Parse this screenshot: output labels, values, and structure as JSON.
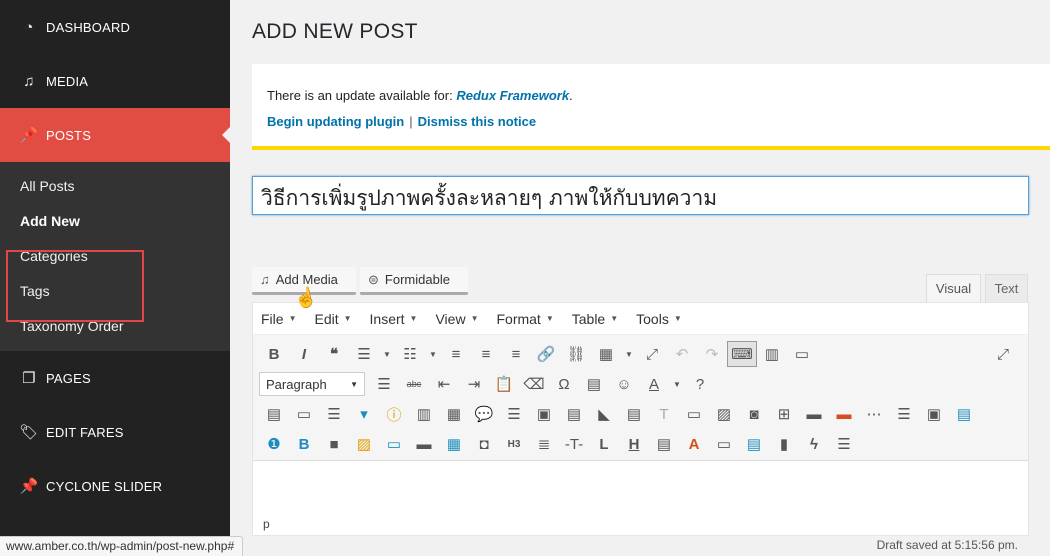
{
  "sidebar": {
    "top_items": [
      {
        "label": "DASHBOARD",
        "icon": "dashboard-icon"
      },
      {
        "label": "MEDIA",
        "icon": "media-icon"
      },
      {
        "label": "POSTS",
        "icon": "pin-icon",
        "active": true
      }
    ],
    "submenu": [
      "All Posts",
      "Add New",
      "Categories",
      "Tags",
      "Taxonomy Order"
    ],
    "bottom_items": [
      {
        "label": "PAGES",
        "icon": "pages-icon"
      },
      {
        "label": "EDIT FARES",
        "icon": "tag-icon"
      },
      {
        "label": "CYCLONE SLIDER",
        "icon": "pin-icon"
      }
    ],
    "colors": {
      "bg": "#222222",
      "active": "#e14d43",
      "submenu_bg": "#333333"
    }
  },
  "page": {
    "title": "ADD NEW POST"
  },
  "notice": {
    "text": "There is an update available for: ",
    "plugin": "Redux Framework",
    "period": ".",
    "begin_link": "Begin updating plugin",
    "separator": "|",
    "dismiss_link": "Dismiss this notice",
    "accent": "#ffd700"
  },
  "post": {
    "title_value": "วิธีการเพิ่มรูปภาพครั้งละหลายๆ ภาพให้กับบทความ"
  },
  "media_buttons": {
    "add_media": "Add Media",
    "formidable": "Formidable"
  },
  "editor_tabs": {
    "visual": "Visual",
    "text": "Text"
  },
  "menubar": [
    "File",
    "Edit",
    "Insert",
    "View",
    "Format",
    "Table",
    "Tools"
  ],
  "toolbar": {
    "format_select": "Paragraph"
  },
  "editor": {
    "path": "p"
  },
  "status": {
    "url": "www.amber.co.th/wp-admin/post-new.php#",
    "draft": "Draft saved at 5:15:56 pm."
  }
}
